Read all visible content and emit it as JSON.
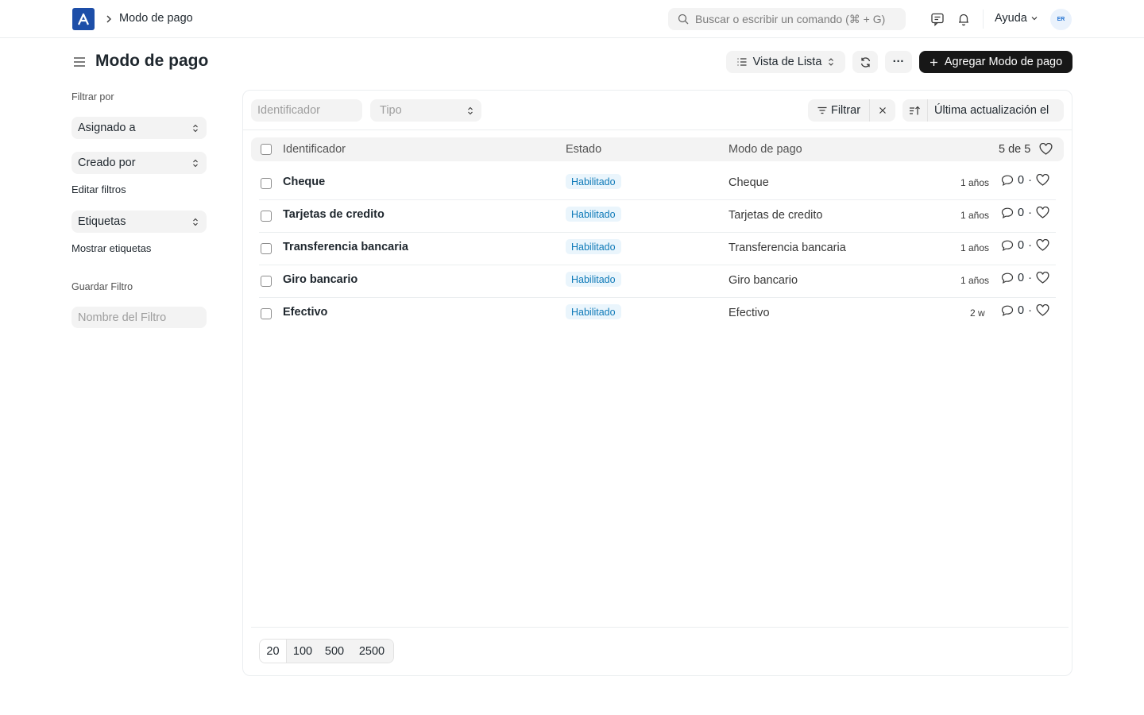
{
  "navbar": {
    "breadcrumb": "Modo de pago",
    "search_placeholder": "Buscar o escribir un comando (⌘ + G)",
    "help_label": "Ayuda",
    "avatar_initials": "ER"
  },
  "page": {
    "title": "Modo de pago",
    "view_label": "Vista de Lista",
    "more_label": "···",
    "add_label": "Agregar Modo de pago"
  },
  "sidebar": {
    "filter_by": "Filtrar por",
    "assigned_to": "Asignado a",
    "created_by": "Creado por",
    "edit_filters": "Editar filtros",
    "tags": "Etiquetas",
    "show_tags": "Mostrar etiquetas",
    "save_filter": "Guardar Filtro",
    "filter_name_placeholder": "Nombre del Filtro"
  },
  "list": {
    "id_filter_placeholder": "Identificador",
    "type_filter_placeholder": "Tipo",
    "filter_label": "Filtrar",
    "sort_label": "Última actualización el",
    "columns": {
      "identifier": "Identificador",
      "status": "Estado",
      "mode": "Modo de pago",
      "count": "5 de 5"
    },
    "rows": [
      {
        "name": "Cheque",
        "status": "Habilitado",
        "mode": "Cheque",
        "time": "1 años",
        "comments": "0"
      },
      {
        "name": "Tarjetas de credito",
        "status": "Habilitado",
        "mode": "Tarjetas de credito",
        "time": "1 años",
        "comments": "0"
      },
      {
        "name": "Transferencia bancaria",
        "status": "Habilitado",
        "mode": "Transferencia bancaria",
        "time": "1 años",
        "comments": "0"
      },
      {
        "name": "Giro bancario",
        "status": "Habilitado",
        "mode": "Giro bancario",
        "time": "1 años",
        "comments": "0"
      },
      {
        "name": "Efectivo",
        "status": "Habilitado",
        "mode": "Efectivo",
        "time": "2 w",
        "comments": "0"
      }
    ],
    "page_sizes": [
      "20",
      "100",
      "500",
      "2500"
    ]
  },
  "colors": {
    "brand": "#1d4ea8",
    "primary_button": "#171717",
    "badge_bg": "#eaf5fc",
    "badge_text": "#0f7ab8"
  },
  "icons": [
    "app-logo-icon",
    "chevron-right-icon",
    "search-icon",
    "chat-icon",
    "bell-icon",
    "chevron-down-icon",
    "hamburger-icon",
    "list-icon",
    "sort-arrows-icon",
    "refresh-icon",
    "plus-icon",
    "filter-icon",
    "close-icon",
    "sort-icon",
    "heart-icon",
    "comment-icon"
  ]
}
